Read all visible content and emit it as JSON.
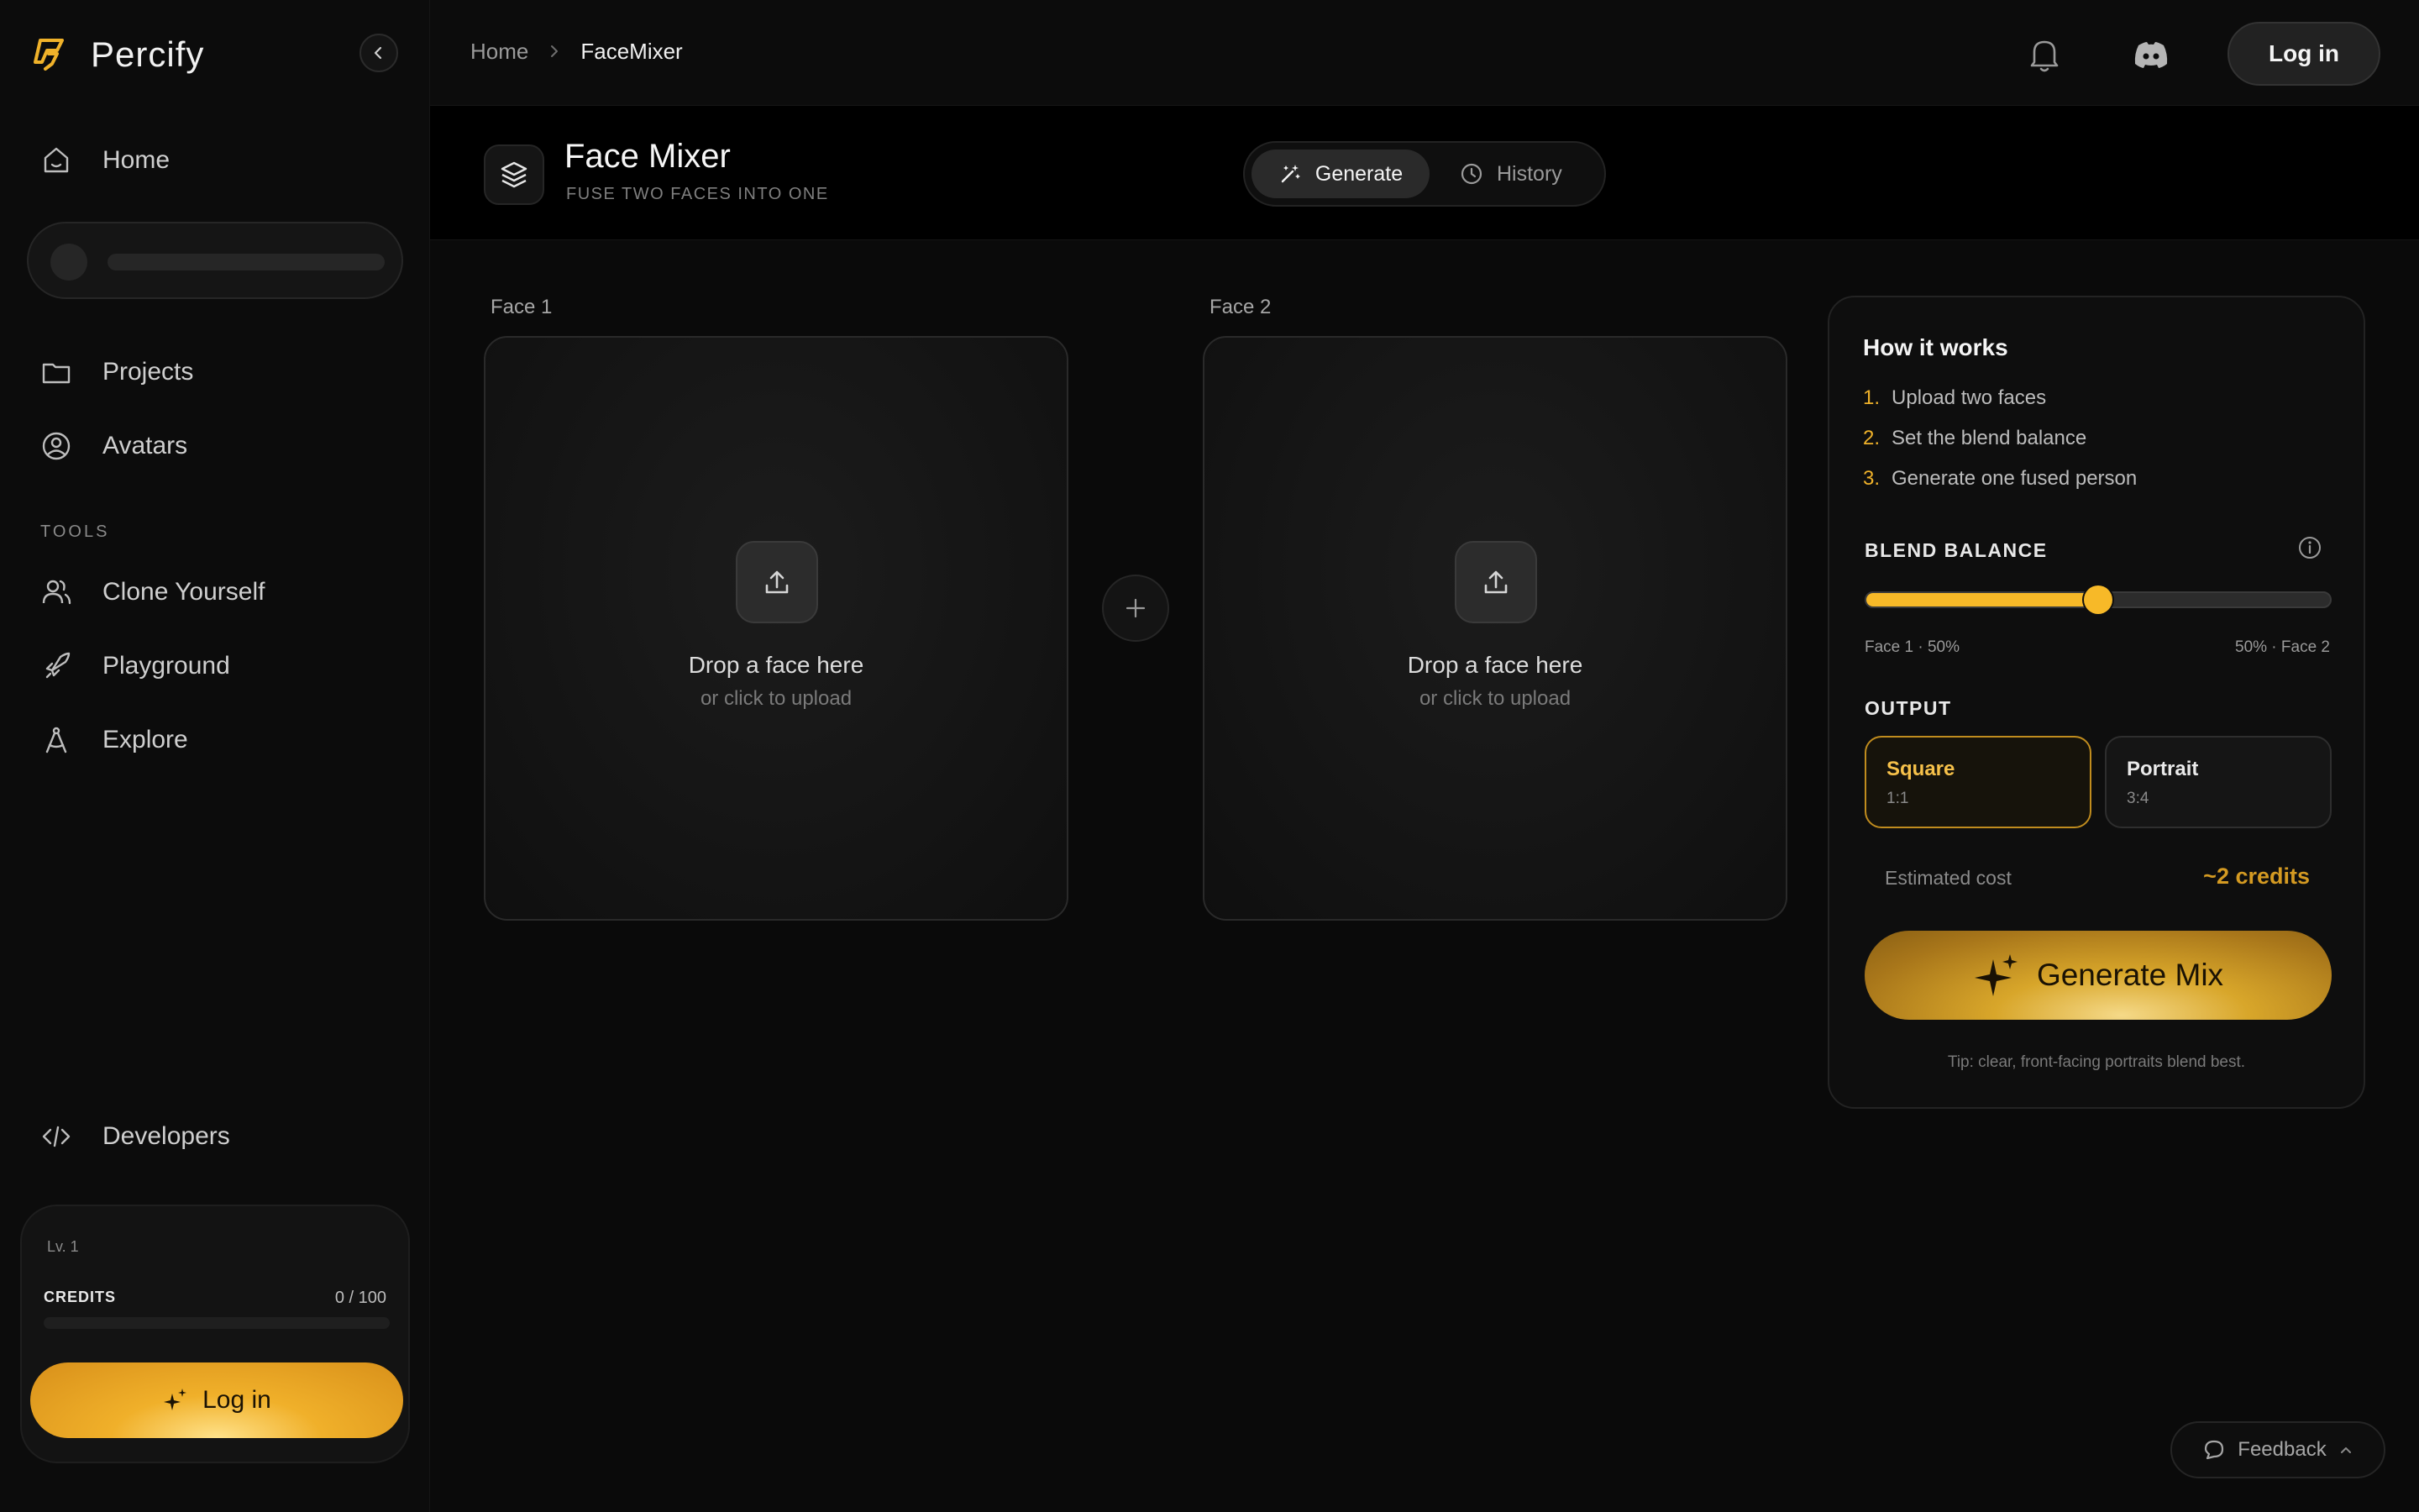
{
  "brand": {
    "name": "Percify",
    "accent": "#f0b22a"
  },
  "sidebar": {
    "home_label": "Home",
    "projects_label": "Projects",
    "avatars_label": "Avatars",
    "tools_section": "TOOLS",
    "clone_label": "Clone Yourself",
    "playground_label": "Playground",
    "explore_label": "Explore",
    "developers_label": "Developers",
    "level": "Lv. 1",
    "credits_label": "CREDITS",
    "credits_value": "0 / 100",
    "credits_progress": 0,
    "login_label": "Log in"
  },
  "topbar": {
    "breadcrumb_home": "Home",
    "breadcrumb_current": "FaceMixer",
    "login_label": "Log in"
  },
  "header": {
    "title": "Face Mixer",
    "subtitle": "FUSE TWO FACES INTO ONE",
    "tab_generate": "Generate",
    "tab_history": "History"
  },
  "faces": {
    "face1_label": "Face 1",
    "face2_label": "Face 2",
    "drop_title": "Drop a face here",
    "drop_sub": "or click to upload"
  },
  "panel": {
    "title": "How it works",
    "steps": [
      {
        "num": "1.",
        "text": "Upload two faces"
      },
      {
        "num": "2.",
        "text": "Set the blend balance"
      },
      {
        "num": "3.",
        "text": "Generate one fused person"
      }
    ],
    "blend_label": "BLEND BALANCE",
    "blend_value": 50,
    "blend_left": "Face 1 · 50%",
    "blend_right": "50% · Face 2",
    "output_label": "OUTPUT",
    "output_square_name": "Square",
    "output_square_ratio": "1:1",
    "output_portrait_name": "Portrait",
    "output_portrait_ratio": "3:4",
    "cost_label": "Estimated cost",
    "cost_value": "~2 credits",
    "generate_label": "Generate Mix",
    "tip": "Tip: clear, front-facing portraits blend best."
  },
  "feedback_label": "Feedback"
}
